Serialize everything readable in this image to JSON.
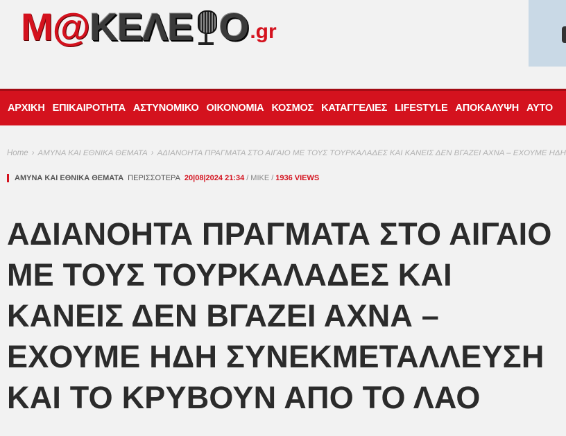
{
  "logo": {
    "prefix_at": "M@",
    "word": "ΚΕΛΕ",
    "suffix": "Ο",
    "tld": ".gr"
  },
  "nav": {
    "items": [
      "ΑΡΧΙΚΗ",
      "ΕΠΙΚΑΙΡΟΤΗΤΑ",
      "ΑΣΤΥΝΟΜΙΚΟ",
      "ΟΙΚΟΝΟΜΙΑ",
      "ΚΟΣΜΟΣ",
      "ΚΑΤΑΓΓΕΛΙΕΣ",
      "LIFESTYLE",
      "ΑΠΟΚΑΛΥΨΗ",
      "ΑΥΤΟ"
    ]
  },
  "breadcrumb": {
    "home": "Home",
    "separator": "›",
    "category": "ΑΜΥΝΑ ΚΑΙ ΕΘΝΙΚΑ ΘΕΜΑΤΑ",
    "current": "ΑΔΙΑΝΟΗΤΑ ΠΡΑΓΜΑΤΑ ΣΤΟ ΑΙΓΑΙΟ ΜΕ ΤΟΥΣ ΤΟΥΡΚΑΛΑΔΕΣ ΚΑΙ ΚΑΝΕΙΣ ΔΕΝ ΒΓΑΖΕΙ ΑΧΝΑ – ΕΧΟΥΜΕ ΗΔΗ ΣΥΝΕΚΜΕ"
  },
  "meta": {
    "category": "ΑΜΥΝΑ ΚΑΙ ΕΘΝΙΚΑ ΘΕΜΑΤΑ",
    "category2": "ΠΕΡΙΣΣΟΤΕΡΑ",
    "date": "20|08|2024 21:34",
    "slash": "/",
    "author": "MIKE",
    "views": "1936 VIEWS"
  },
  "article": {
    "title": "ΑΔΙΑΝΟΗΤΑ ΠΡΑΓΜΑΤΑ ΣΤΟ ΑΙΓΑΙΟ ΜΕ ΤΟΥΣ ΤΟΥΡΚΑΛΑΔΕΣ ΚΑΙ ΚΑΝΕΙΣ ΔΕΝ ΒΓΑΖΕΙ ΑΧΝΑ – ΕΧΟΥΜΕ ΗΔΗ ΣΥΝΕΚΜΕΤΑΛΛΕΥΣΗ ΚΑΙ ΤΟ ΚΡΥΒΟΥΝ ΑΠΟ ΤΟ ΛΑΟ"
  },
  "colors": {
    "accent": "#d4121e",
    "text": "#2b2b2b",
    "background": "#f2f2f2"
  }
}
